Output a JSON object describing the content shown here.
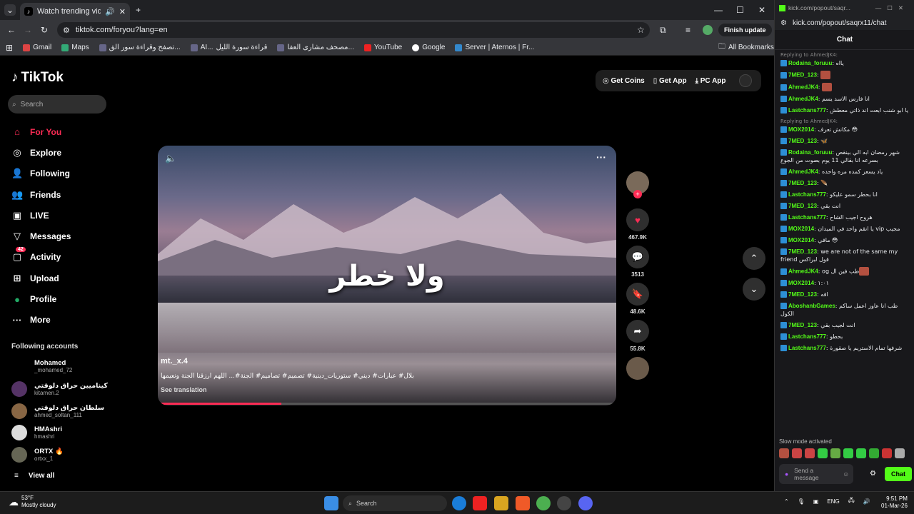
{
  "browser": {
    "tab_title": "Watch trending videos for y",
    "url": "tiktok.com/foryou?lang=en",
    "finish_update": "Finish update",
    "bookmarks": [
      "Gmail",
      "Maps",
      "تصفح وقراءة سور الق...",
      "AI...",
      "قراءة سورة الليل",
      "مصحف مشارى العفا...",
      "YouTube",
      "Google",
      "Server | Aternos | Fr..."
    ],
    "all_bookmarks": "All Bookmarks"
  },
  "tiktok": {
    "logo": "TikTok",
    "search_placeholder": "Search",
    "nav": [
      {
        "label": "For You",
        "icon": "home-icon"
      },
      {
        "label": "Explore",
        "icon": "compass-icon"
      },
      {
        "label": "Following",
        "icon": "following-icon"
      },
      {
        "label": "Friends",
        "icon": "friends-icon"
      },
      {
        "label": "LIVE",
        "icon": "live-icon"
      },
      {
        "label": "Messages",
        "icon": "messages-icon"
      },
      {
        "label": "Activity",
        "icon": "activity-icon",
        "badge": "42"
      },
      {
        "label": "Upload",
        "icon": "upload-icon"
      },
      {
        "label": "Profile",
        "icon": "profile-icon"
      },
      {
        "label": "More",
        "icon": "more-icon"
      }
    ],
    "following_title": "Following accounts",
    "accounts": [
      {
        "name": "Mohamed",
        "handle": "_mohamed_72"
      },
      {
        "name": "كيناميين حراق دلوقتي",
        "handle": "kitamen.2"
      },
      {
        "name": "سلطان حراق دلوقتي",
        "handle": "ahmed_soltan_111"
      },
      {
        "name": "HMAshri",
        "handle": "hmashri"
      },
      {
        "name": "ORTX",
        "handle": "ortxx_1"
      }
    ],
    "view_all": "View all",
    "top_buttons": {
      "coins": "Get Coins",
      "app": "Get App",
      "pc": "PC App"
    },
    "video": {
      "overlay_text": "ولا خطر",
      "username": "mt._x.4",
      "caption": "بلال# عبارات# ديني# ستوريات_دينية# تصميم# تصاميم# الجنة#... اللهم ارزقنا الجنة ونعيمها",
      "see_translation": "See translation",
      "progress": 0.27
    },
    "actions": {
      "likes": "467.9K",
      "comments": "3513",
      "saves": "48.6K",
      "shares": "55.8K"
    }
  },
  "kick": {
    "window_title": "kick.com/popout/saqr...",
    "url": "kick.com/popout/saqrx11/chat",
    "header": "Chat",
    "messages": [
      {
        "reply": "Replying to AhmedJK4:",
        "user": "Rodaina_foruuu",
        "text": "يااه"
      },
      {
        "user": "7MED_123",
        "text": "",
        "emote": true
      },
      {
        "user": "AhmedJK4",
        "text": "",
        "emote": true
      },
      {
        "user": "AhmedJK4",
        "text": "انا فارس الاسد يسم"
      },
      {
        "user": "Lastchans777",
        "text": "يا ابو شنب ابعت اند ذاتي معطش"
      },
      {
        "reply": "Replying to AhmedJK4:",
        "user": "MOX2014",
        "text": "مكانش تعرف 😳"
      },
      {
        "user": "7MED_123",
        "text": "🦋"
      },
      {
        "user": "Rodaina_foruuu",
        "text": "شهر رمضان ابه الي بينقص بسرعه انا بقالي 11 يوم بصوت من الجوع"
      },
      {
        "user": "AhmedJK4",
        "text": "ياد يسعر كمده مره واحده"
      },
      {
        "user": "7MED_123",
        "text": "🪶"
      },
      {
        "user": "Lastchans777",
        "text": "انا بحطر سمو عليكو"
      },
      {
        "user": "7MED_123",
        "text": "انت بقي"
      },
      {
        "user": "Lastchans777",
        "text": "هروح اجيب الشاح"
      },
      {
        "user": "MOX2014",
        "text": "يا انقم واحد في الميدان vip مجيب"
      },
      {
        "user": "MOX2014",
        "text": "مافي 😳"
      },
      {
        "user": "7MED_123",
        "text": "we are not of the same my friend قول لبراكس"
      },
      {
        "user": "AhmedJK4",
        "text": "og طب فين ال",
        "emote": true
      },
      {
        "user": "MOX2014",
        "text": "١:٠١"
      },
      {
        "user": "7MED_123",
        "text": "اقه"
      },
      {
        "user": "AboshanbGames",
        "text": "طب انا عاوز اعمل ساكم الكول"
      },
      {
        "user": "7MED_123",
        "text": "انت لجيب بقي"
      },
      {
        "user": "Lastchans777",
        "text": "بحطو"
      },
      {
        "user": "Lastchans777",
        "text": "شرفها تمام الاستريم يا صقورة"
      }
    ],
    "slow_mode": "Slow mode activated",
    "send_placeholder": "Send a message",
    "chat_button": "Chat"
  },
  "taskbar": {
    "temp": "53°F",
    "weather": "Mostly cloudy",
    "search": "Search",
    "lang": "ENG",
    "time": "9:51 PM",
    "date": "01-Mar-26"
  }
}
